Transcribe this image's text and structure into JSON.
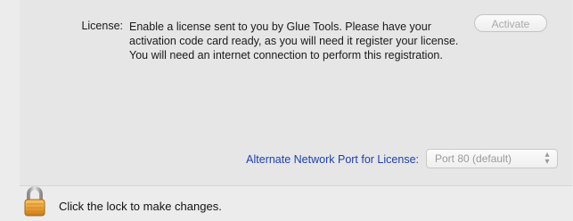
{
  "license": {
    "label": "License:",
    "description": "Enable a license sent to you by Glue Tools. Please have your activation code card ready, as you will need it register your license. You will need an internet connection to perform this registration.",
    "activate_label": "Activate"
  },
  "network": {
    "port_label": "Alternate Network Port for License:",
    "port_value": "Port 80 (default)"
  },
  "lock": {
    "icon": "padlock-icon",
    "message": "Click the lock to make changes."
  },
  "colors": {
    "background": "#ececec",
    "link_blue": "#1f3fae",
    "disabled_text": "#a9a9a9",
    "lock_gold": "#e8a23a"
  }
}
